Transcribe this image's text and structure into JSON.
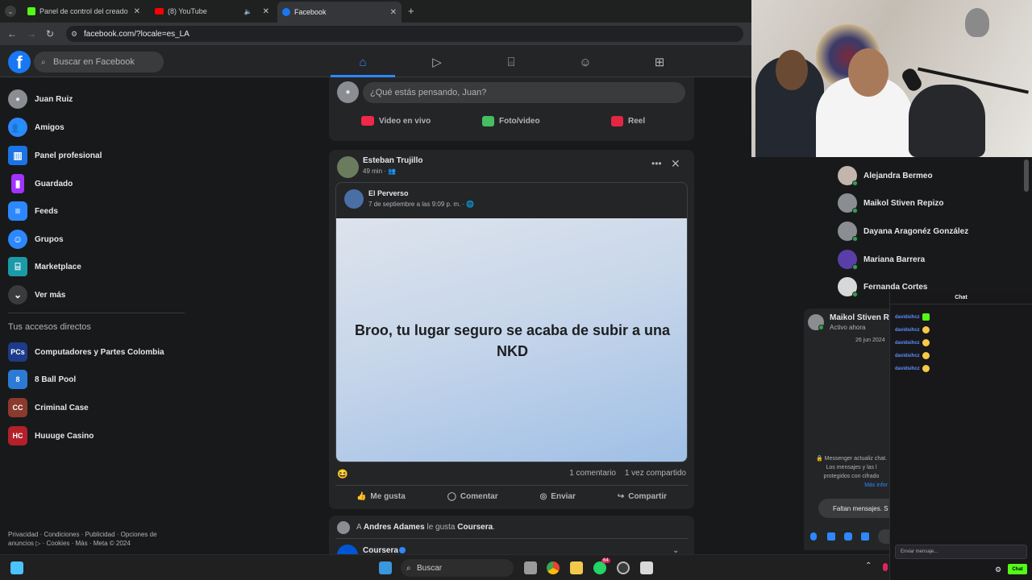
{
  "browser": {
    "tabs": [
      {
        "label": "Panel de control del creador | K",
        "icon": "kick-icon",
        "color": "#53fc18"
      },
      {
        "label": "(8) YouTube",
        "icon": "youtube-icon",
        "color": "#ff0000"
      },
      {
        "label": "Facebook",
        "icon": "facebook-icon",
        "color": "#1877f2"
      }
    ],
    "url": "facebook.com/?locale=es_LA"
  },
  "header": {
    "logo": "f",
    "search_placeholder": "Buscar en Facebook",
    "nav": [
      "home-icon",
      "watch-icon",
      "marketplace-icon",
      "groups-icon",
      "gaming-icon"
    ]
  },
  "sidebar": {
    "items": [
      {
        "label": "Juan Ruiz",
        "icon": "avatar"
      },
      {
        "label": "Amigos",
        "icon": "friends-icon"
      },
      {
        "label": "Panel profesional",
        "icon": "dashboard-icon"
      },
      {
        "label": "Guardado",
        "icon": "bookmark-icon"
      },
      {
        "label": "Feeds",
        "icon": "feeds-icon"
      },
      {
        "label": "Grupos",
        "icon": "groups-icon"
      },
      {
        "label": "Marketplace",
        "icon": "marketplace-icon"
      },
      {
        "label": "Ver más",
        "icon": "chevron-down-icon"
      }
    ],
    "shortcuts_title": "Tus accesos directos",
    "shortcuts": [
      {
        "label": "Computadores y Partes Colombia",
        "badge": "PCs"
      },
      {
        "label": "8 Ball Pool",
        "badge": "8"
      },
      {
        "label": "Criminal Case",
        "badge": "CC"
      },
      {
        "label": "Huuuge Casino",
        "badge": "HC"
      }
    ],
    "footer": "Privacidad · Condiciones · Publicidad · Opciones de anuncios ▷ · Cookies · Más · Meta © 2024"
  },
  "composer": {
    "placeholder": "¿Qué estás pensando, Juan?",
    "actions": [
      {
        "label": "Video en vivo",
        "color": "#f02849"
      },
      {
        "label": "Foto/video",
        "color": "#45bd62"
      },
      {
        "label": "Reel",
        "color": "#e42645"
      }
    ]
  },
  "post": {
    "author": "Esteban Trujillo",
    "meta": "49 min · 👥",
    "shared_author": "El Perverso",
    "shared_meta": "7 de septiembre a las 9:09 p. m. · 🌐",
    "shared_text": "Broo, tu lugar seguro se acaba de subir a una NKD",
    "reaction": "😆",
    "comments": "1 comentario",
    "shares": "1 vez compartido",
    "actions": [
      "Me gusta",
      "Comentar",
      "Enviar",
      "Compartir"
    ]
  },
  "post2": {
    "prefix": "A",
    "friend": "Andres Adames",
    "middle": "le gusta",
    "page": "Coursera",
    "page_name": "Coursera"
  },
  "contacts": [
    {
      "name": "Alejandra Bermeo"
    },
    {
      "name": "Maikol Stiven Repizo"
    },
    {
      "name": "Dayana Aragonéz González"
    },
    {
      "name": "Mariana Barrera"
    },
    {
      "name": "Fernanda Cortes"
    }
  ],
  "messenger": {
    "name": "Maikol Stiven Re",
    "status": "Activo ahora",
    "date": "26 jun 2024",
    "notice": "Messenger actualiz chat. Los mensajes y las l protegidos con cifrado",
    "more": "Más infor",
    "missing": "Faltan mensajes. S"
  },
  "stream_chat": {
    "title": "Chat",
    "user": "davidsihcz",
    "lines": 5,
    "input_placeholder": "Enviar mensaje...",
    "button": "Chat"
  },
  "taskbar": {
    "search": "Buscar",
    "whatsapp_badge": "64"
  }
}
